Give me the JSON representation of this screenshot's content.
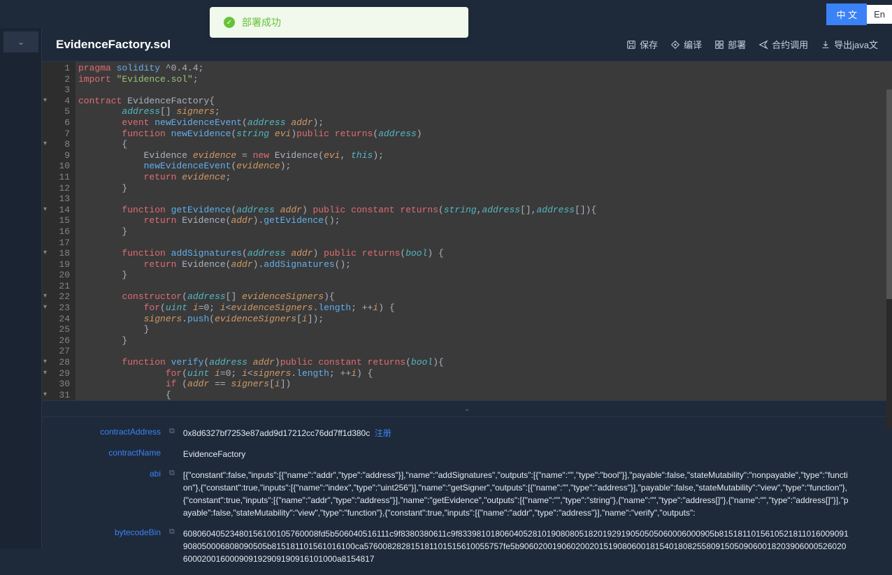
{
  "lang": {
    "cn": "中 文",
    "en": "En"
  },
  "notification": {
    "text": "部署成功"
  },
  "file": {
    "title": "EvidenceFactory.sol"
  },
  "toolbar": {
    "save": "保存",
    "compile": "编译",
    "deploy": "部署",
    "invoke": "合约调用",
    "export": "导出java文"
  },
  "code_lines": [
    "pragma solidity ^0.4.4;",
    "import \"Evidence.sol\";",
    "",
    "contract EvidenceFactory{",
    "        address[] signers;",
    "        event newEvidenceEvent(address addr);",
    "        function newEvidence(string evi)public returns(address)",
    "        {",
    "            Evidence evidence = new Evidence(evi, this);",
    "            newEvidenceEvent(evidence);",
    "            return evidence;",
    "        }",
    "",
    "        function getEvidence(address addr) public constant returns(string,address[],address[]){",
    "            return Evidence(addr).getEvidence();",
    "        }",
    "",
    "        function addSignatures(address addr) public returns(bool) {",
    "            return Evidence(addr).addSignatures();",
    "        }",
    "",
    "        constructor(address[] evidenceSigners){",
    "            for(uint i=0; i<evidenceSigners.length; ++i) {",
    "            signers.push(evidenceSigners[i]);",
    "            }",
    "        }",
    "",
    "        function verify(address addr)public constant returns(bool){",
    "                for(uint i=0; i<signers.length; ++i) {",
    "                if (addr == signers[i])",
    "                {"
  ],
  "fold_lines": [
    4,
    8,
    14,
    18,
    22,
    23,
    28,
    29,
    31
  ],
  "info": {
    "contractAddress": {
      "label": "contractAddress",
      "value": "0x8d6327bf7253e87add9d17212cc76dd7ff1d380c",
      "link": "注册"
    },
    "contractName": {
      "label": "contractName",
      "value": "EvidenceFactory"
    },
    "abi": {
      "label": "abi",
      "value": "[{\"constant\":false,\"inputs\":[{\"name\":\"addr\",\"type\":\"address\"}],\"name\":\"addSignatures\",\"outputs\":[{\"name\":\"\",\"type\":\"bool\"}],\"payable\":false,\"stateMutability\":\"nonpayable\",\"type\":\"function\"},{\"constant\":true,\"inputs\":[{\"name\":\"index\",\"type\":\"uint256\"}],\"name\":\"getSigner\",\"outputs\":[{\"name\":\"\",\"type\":\"address\"}],\"payable\":false,\"stateMutability\":\"view\",\"type\":\"function\"},{\"constant\":true,\"inputs\":[{\"name\":\"addr\",\"type\":\"address\"}],\"name\":\"getEvidence\",\"outputs\":[{\"name\":\"\",\"type\":\"string\"},{\"name\":\"\",\"type\":\"address[]\"},{\"name\":\"\",\"type\":\"address[]\"}],\"payable\":false,\"stateMutability\":\"view\",\"type\":\"function\"},{\"constant\":true,\"inputs\":[{\"name\":\"addr\",\"type\":\"address\"}],\"name\":\"verify\",\"outputs\":"
    },
    "bytecodeBin": {
      "label": "bytecodeBin",
      "value": "60806040523480156100105760008fd5b506040516111c9f8380380611c9f8339810180604052810190808051820192919050505060006000905b8151811015610521811016009091908050006808090505b815181101561016100ca576008282815181101515610055757fe5b9060200190602002015190806001815401808255809150509060018203906000526020600020016000909192909190916101000a8154817"
    }
  }
}
